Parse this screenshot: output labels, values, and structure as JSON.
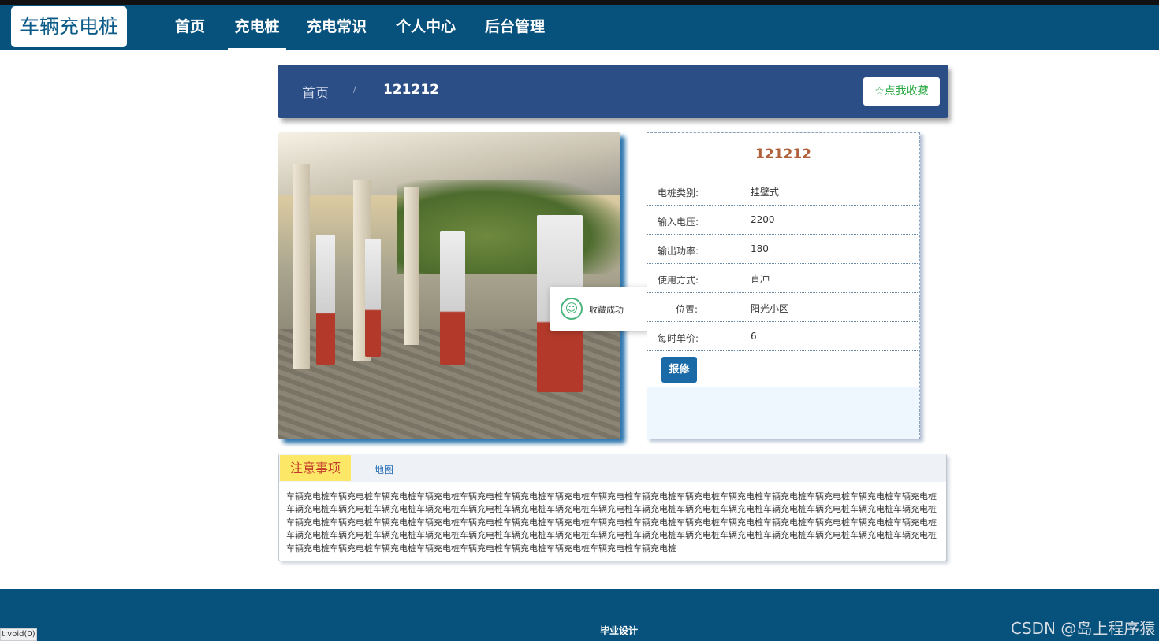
{
  "brand": {
    "logo": "车辆充电桩"
  },
  "nav": {
    "items": [
      "首页",
      "充电桩",
      "充电常识",
      "个人中心",
      "后台管理"
    ],
    "active": "充电桩"
  },
  "breadcrumb": {
    "home": "首页",
    "separator": "/",
    "current": "121212"
  },
  "favorite_button": "☆点我收藏",
  "toast": {
    "icon": "smile-icon",
    "text": "收藏成功"
  },
  "detail": {
    "title": "121212",
    "fields": [
      {
        "label": "电桩类别:",
        "value": "挂壁式"
      },
      {
        "label": "输入电压:",
        "value": "2200"
      },
      {
        "label": "输出功率:",
        "value": "180"
      },
      {
        "label": "使用方式:",
        "value": "直冲"
      },
      {
        "label": "位置:",
        "value": "阳光小区"
      },
      {
        "label": "每时单价:",
        "value": "6"
      }
    ],
    "repair_button": "报修"
  },
  "notes": {
    "tabs": [
      "注意事项",
      "地图"
    ],
    "content": "车辆充电桩车辆充电桩车辆充电桩车辆充电桩车辆充电桩车辆充电桩车辆充电桩车辆充电桩车辆充电桩车辆充电桩车辆充电桩车辆充电桩车辆充电桩车辆充电桩车辆充电桩车辆充电桩车辆充电桩车辆充电桩车辆充电桩车辆充电桩车辆充电桩车辆充电桩车辆充电桩车辆充电桩车辆充电桩车辆充电桩车辆充电桩车辆充电桩车辆充电桩车辆充电桩车辆充电桩车辆充电桩车辆充电桩车辆充电桩车辆充电桩车辆充电桩车辆充电桩车辆充电桩车辆充电桩车辆充电桩车辆充电桩车辆充电桩车辆充电桩车辆充电桩车辆充电桩车辆充电桩车辆充电桩车辆充电桩车辆充电桩车辆充电桩车辆充电桩车辆充电桩车辆充电桩车辆充电桩车辆充电桩车辆充电桩车辆充电桩车辆充电桩车辆充电桩车辆充电桩车辆充电桩车辆充电桩车辆充电桩车辆充电桩车辆充电桩车辆充电桩车辆充电桩车辆充电桩车辆充电桩"
  },
  "footer": {
    "text": "毕业设计"
  },
  "statusbar": {
    "text": "t:void(0)"
  },
  "watermark": "CSDN @岛上程序猿"
}
